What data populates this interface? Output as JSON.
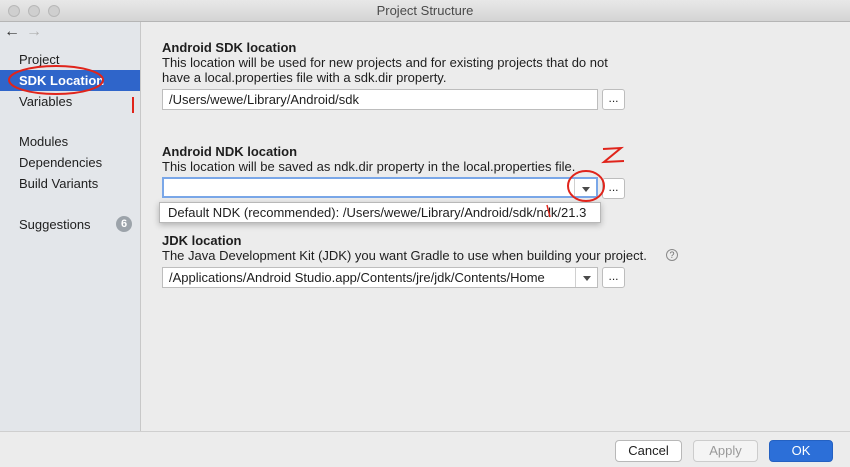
{
  "window": {
    "title": "Project Structure"
  },
  "nav": {
    "back_icon": "←",
    "forward_icon": "→"
  },
  "sidebar": {
    "items": [
      {
        "label": "Project"
      },
      {
        "label": "SDK Location"
      },
      {
        "label": "Variables"
      },
      {
        "label": "Modules"
      },
      {
        "label": "Dependencies"
      },
      {
        "label": "Build Variants"
      },
      {
        "label": "Suggestions",
        "badge": "6"
      }
    ],
    "selected": "SDK Location"
  },
  "sdk": {
    "title": "Android SDK location",
    "description": "This location will be used for new projects and for existing projects that do not have a local.properties file with a sdk.dir property.",
    "value": "/Users/wewe/Library/Android/sdk",
    "browse_label": "..."
  },
  "ndk": {
    "title": "Android NDK location",
    "description": "This location will be saved as ndk.dir property in the local.properties file.",
    "value": "",
    "browse_label": "...",
    "dropdown_option": "Default NDK (recommended): /Users/wewe/Library/Android/sdk/ndk/21.3"
  },
  "jdk": {
    "title": "JDK location",
    "description": "The Java Development Kit (JDK) you want Gradle to use when building your project.",
    "help_icon": "?",
    "value": "/Applications/Android Studio.app/Contents/jre/jdk/Contents/Home",
    "browse_label": "..."
  },
  "annotations": {
    "mark_1": "I",
    "mark_2": "Z"
  },
  "footer": {
    "cancel_label": "Cancel",
    "apply_label": "Apply",
    "ok_label": "OK"
  },
  "colors": {
    "selection": "#2f65ca",
    "primary_button": "#2c6fd8",
    "annotation": "#e0241b"
  }
}
